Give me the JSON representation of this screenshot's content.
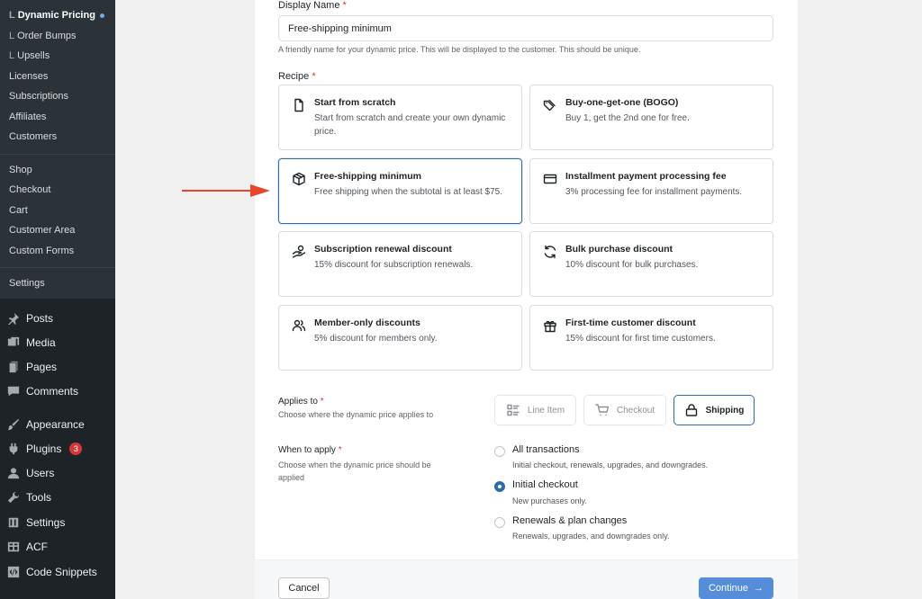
{
  "sidebar": {
    "submenu": [
      {
        "label": "Dynamic Pricing",
        "prefix": "L",
        "active": true
      },
      {
        "label": "Order Bumps",
        "prefix": "L"
      },
      {
        "label": "Upsells",
        "prefix": "L"
      },
      {
        "label": "Licenses"
      },
      {
        "label": "Subscriptions"
      },
      {
        "label": "Affiliates"
      },
      {
        "label": "Customers"
      },
      {
        "label": "Shop"
      },
      {
        "label": "Checkout"
      },
      {
        "label": "Cart"
      },
      {
        "label": "Customer Area"
      },
      {
        "label": "Custom Forms"
      },
      {
        "label": "Settings"
      }
    ],
    "main": [
      {
        "label": "Posts",
        "icon": "pin-icon"
      },
      {
        "label": "Media",
        "icon": "media-icon"
      },
      {
        "label": "Pages",
        "icon": "pages-icon"
      },
      {
        "label": "Comments",
        "icon": "comment-icon"
      },
      {
        "label": "Appearance",
        "icon": "brush-icon"
      },
      {
        "label": "Plugins",
        "icon": "plugin-icon",
        "badge": "3"
      },
      {
        "label": "Users",
        "icon": "user-icon"
      },
      {
        "label": "Tools",
        "icon": "wrench-icon"
      },
      {
        "label": "Settings",
        "icon": "sliders-icon"
      },
      {
        "label": "ACF",
        "icon": "grid-icon"
      },
      {
        "label": "Code Snippets",
        "icon": "code-icon"
      }
    ]
  },
  "form": {
    "display_name": {
      "label": "Display Name",
      "required": "*",
      "value": "Free-shipping minimum",
      "help": "A friendly name for your dynamic price. This will be displayed to the customer. This should be unique."
    },
    "recipe": {
      "label": "Recipe",
      "required": "*",
      "cards": [
        {
          "title": "Start from scratch",
          "desc": "Start from scratch and create your own dynamic price.",
          "icon": "file-icon"
        },
        {
          "title": "Buy-one-get-one (BOGO)",
          "desc": "Buy 1, get the 2nd one for free.",
          "icon": "tags-icon"
        },
        {
          "title": "Free-shipping minimum",
          "desc": "Free shipping when the subtotal is at least $75.",
          "icon": "box-icon",
          "selected": true
        },
        {
          "title": "Installment payment processing fee",
          "desc": "3% processing fee for installment payments.",
          "icon": "credit-card-icon"
        },
        {
          "title": "Subscription renewal discount",
          "desc": "15% discount for subscription renewals.",
          "icon": "hand-coin-icon"
        },
        {
          "title": "Bulk purchase discount",
          "desc": "10% discount for bulk purchases.",
          "icon": "refresh-icon"
        },
        {
          "title": "Member-only discounts",
          "desc": "5% discount for members only.",
          "icon": "users-icon"
        },
        {
          "title": "First-time customer discount",
          "desc": "15% discount for first time customers.",
          "icon": "gift-icon"
        }
      ]
    },
    "applies_to": {
      "label": "Applies to",
      "required": "*",
      "help": "Choose where the dynamic price applies to",
      "options": [
        {
          "label": "Line Item",
          "icon": "list-icon"
        },
        {
          "label": "Checkout",
          "icon": "cart-icon"
        },
        {
          "label": "Shipping",
          "icon": "lock-icon",
          "selected": true
        }
      ]
    },
    "when_to_apply": {
      "label": "When to apply",
      "required": "*",
      "help": "Choose when the dynamic price should be applied",
      "options": [
        {
          "title": "All transactions",
          "desc": "Initial checkout, renewals, upgrades, and downgrades."
        },
        {
          "title": "Initial checkout",
          "desc": "New purchases only.",
          "selected": true
        },
        {
          "title": "Renewals & plan changes",
          "desc": "Renewals, upgrades, and downgrades only."
        }
      ]
    },
    "buttons": {
      "cancel": "Cancel",
      "continue": "Continue",
      "continue_arrow": "→"
    }
  },
  "colors": {
    "accent": "#2b6cb0",
    "annotation_arrow": "#e8452c",
    "required": "#d63638",
    "sidebar_bg": "#1d2327"
  }
}
